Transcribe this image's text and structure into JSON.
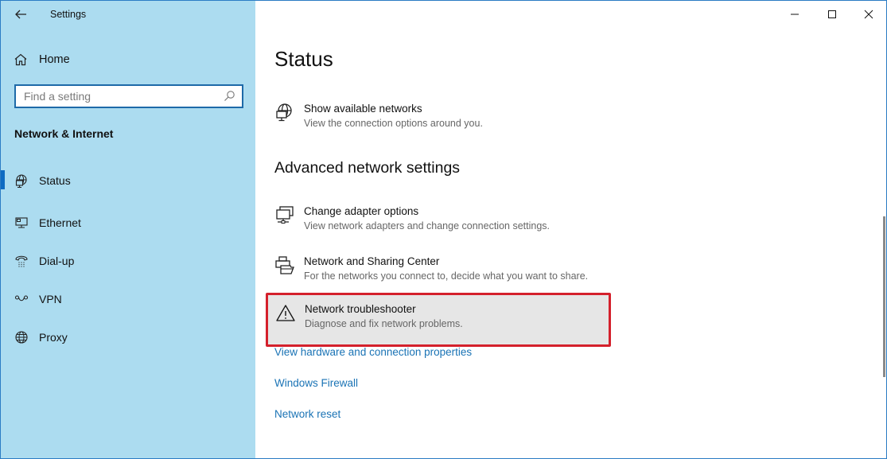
{
  "window": {
    "title": "Settings",
    "controls": {
      "minimize": "minimize-icon",
      "maximize": "maximize-icon",
      "close": "close-icon"
    }
  },
  "sidebar": {
    "back_icon": "back-arrow-icon",
    "home": {
      "label": "Home",
      "icon": "home-icon"
    },
    "search": {
      "placeholder": "Find a setting",
      "value": "",
      "icon": "search-icon"
    },
    "section_title": "Network & Internet",
    "items": [
      {
        "label": "Status",
        "icon": "globe-monitor-icon",
        "active": true
      },
      {
        "label": "Ethernet",
        "icon": "ethernet-icon",
        "active": false
      },
      {
        "label": "Dial-up",
        "icon": "dial-up-phone-icon",
        "active": false
      },
      {
        "label": "VPN",
        "icon": "vpn-icon",
        "active": false
      },
      {
        "label": "Proxy",
        "icon": "globe-icon",
        "active": false
      }
    ],
    "colors": {
      "background": "#acdcf0",
      "active_indicator": "#0e6bc2"
    }
  },
  "main": {
    "title": "Status",
    "show_networks": {
      "title": "Show available networks",
      "subtitle": "View the connection options around you.",
      "icon": "globe-monitor-icon"
    },
    "advanced_title": "Advanced network settings",
    "advanced_items": [
      {
        "title": "Change adapter options",
        "subtitle": "View network adapters and change connection settings.",
        "icon": "network-adapter-icon"
      },
      {
        "title": "Network and Sharing Center",
        "subtitle": "For the networks you connect to, decide what you want to share.",
        "icon": "printer-folder-icon"
      },
      {
        "title": "Network troubleshooter",
        "subtitle": "Diagnose and fix network problems.",
        "icon": "warning-icon",
        "highlighted": true
      }
    ],
    "links": [
      "View hardware and connection properties",
      "Windows Firewall",
      "Network reset"
    ],
    "colors": {
      "link": "#1a73b5",
      "highlight_frame": "#d4202c",
      "hover_bg": "#e6e6e6"
    }
  }
}
